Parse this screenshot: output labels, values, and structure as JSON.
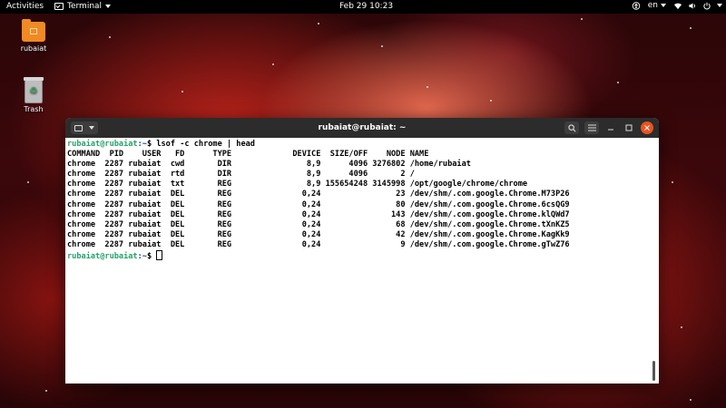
{
  "topbar": {
    "activities": "Activities",
    "app_menu": "Terminal",
    "clock": "Feb 29  10:23",
    "language": "en"
  },
  "desktop": {
    "icons": [
      {
        "label": "rubaiat",
        "icon": "home-folder-icon"
      },
      {
        "label": "Trash",
        "icon": "trash-icon"
      }
    ]
  },
  "window": {
    "title": "rubaiat@rubaiat: ~"
  },
  "terminal": {
    "prompt_user": "rubaiat@rubaiat",
    "prompt_path": ":~",
    "prompt_symbol": "$ ",
    "command": "lsof -c chrome | head",
    "header": "COMMAND  PID    USER   FD      TYPE             DEVICE  SIZE/OFF    NODE NAME",
    "rows": [
      "chrome  2287 rubaiat  cwd       DIR                8,9      4096 3276802 /home/rubaiat",
      "chrome  2287 rubaiat  rtd       DIR                8,9      4096       2 /",
      "chrome  2287 rubaiat  txt       REG                8,9 155654248 3145998 /opt/google/chrome/chrome",
      "chrome  2287 rubaiat  DEL       REG               0,24                23 /dev/shm/.com.google.Chrome.M73P26",
      "chrome  2287 rubaiat  DEL       REG               0,24                80 /dev/shm/.com.google.Chrome.6csQG9",
      "chrome  2287 rubaiat  DEL       REG               0,24               143 /dev/shm/.com.google.Chrome.klQWd7",
      "chrome  2287 rubaiat  DEL       REG               0,24                68 /dev/shm/.com.google.Chrome.tXnKZ5",
      "chrome  2287 rubaiat  DEL       REG               0,24                42 /dev/shm/.com.google.Chrome.KagKk9",
      "chrome  2287 rubaiat  DEL       REG               0,24                 9 /dev/shm/.com.google.Chrome.gTwZ76"
    ]
  },
  "colors": {
    "accent_close": "#e95420",
    "prompt_green": "#26a269",
    "path_blue": "#12488b"
  }
}
